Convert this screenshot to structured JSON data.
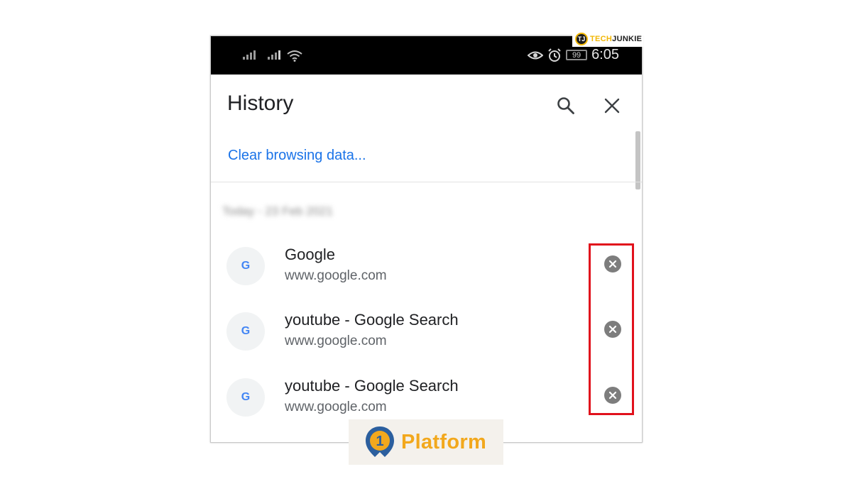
{
  "status_bar": {
    "time": "6:05",
    "battery": "99",
    "icons": [
      "signal-icon",
      "signal-icon",
      "wifi-icon",
      "eye-icon",
      "alarm-icon",
      "battery-icon"
    ]
  },
  "watermark": {
    "badge": "TJ",
    "text_tech": "TECH",
    "text_junkie": "JUNKIE"
  },
  "header": {
    "title": "History",
    "search_icon": "search-icon",
    "close_icon": "close-icon"
  },
  "clear_link": "Clear browsing data...",
  "date_heading": "Today - 23 Feb 2021",
  "history": [
    {
      "favicon": "G",
      "title": "Google",
      "url": "www.google.com"
    },
    {
      "favicon": "G",
      "title": "youtube - Google Search",
      "url": "www.google.com"
    },
    {
      "favicon": "G",
      "title": "youtube - Google Search",
      "url": "www.google.com"
    }
  ],
  "platform_logo": {
    "digit": "1",
    "text": "Platform"
  },
  "colors": {
    "link": "#1a73e8",
    "highlight": "#e1111c",
    "status_bar": "#000000",
    "brand": "#f2a81d"
  }
}
